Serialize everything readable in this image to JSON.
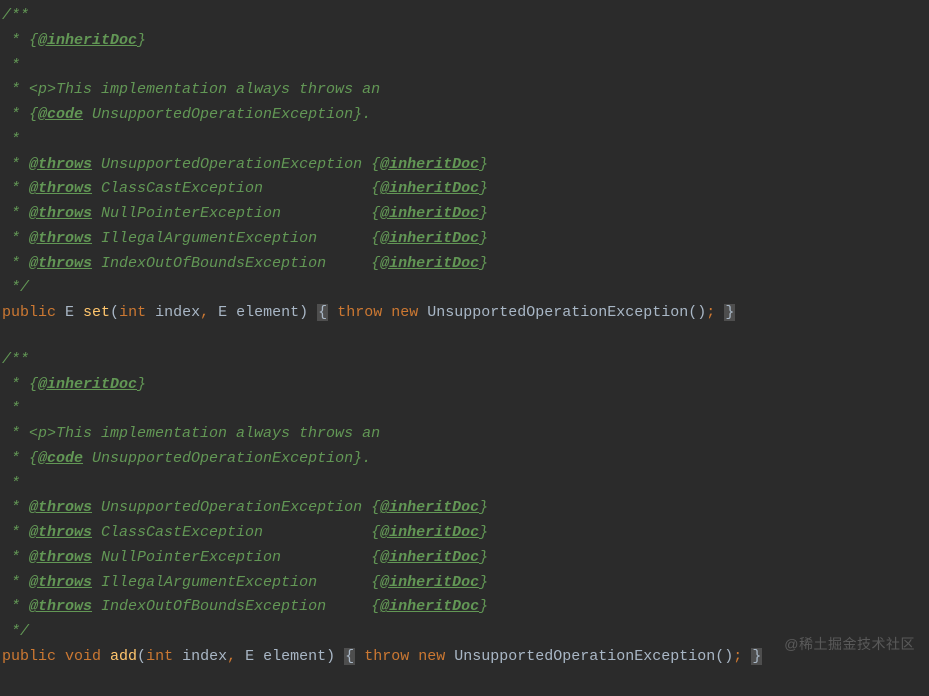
{
  "blocks": [
    {
      "doc": {
        "open": "/**",
        "inheritHeader": {
          "prefix": " * {",
          "tag": "@inheritDoc",
          "suffix": "}"
        },
        "blank1": " *",
        "desc1": {
          "prefix": " * <p>",
          "text": "This implementation always throws an"
        },
        "desc2": {
          "prefix": " * {",
          "tag": "@code",
          "text": " UnsupportedOperationException}."
        },
        "blank2": " *",
        "throws": [
          {
            "prefix": " * ",
            "tag": "@throws",
            "exc": " UnsupportedOperationException ",
            "open": "{",
            "tag2": "@inheritDoc",
            "close": "}"
          },
          {
            "prefix": " * ",
            "tag": "@throws",
            "exc": " ClassCastException            ",
            "open": "{",
            "tag2": "@inheritDoc",
            "close": "}"
          },
          {
            "prefix": " * ",
            "tag": "@throws",
            "exc": " NullPointerException          ",
            "open": "{",
            "tag2": "@inheritDoc",
            "close": "}"
          },
          {
            "prefix": " * ",
            "tag": "@throws",
            "exc": " IllegalArgumentException      ",
            "open": "{",
            "tag2": "@inheritDoc",
            "close": "}"
          },
          {
            "prefix": " * ",
            "tag": "@throws",
            "exc": " IndexOutOfBoundsException     ",
            "open": "{",
            "tag2": "@inheritDoc",
            "close": "}"
          }
        ],
        "close": " */"
      },
      "sig": {
        "kw_public": "public",
        "ret": " E ",
        "name": "set",
        "paramsOpen": "(",
        "kw_int": "int",
        "p1": " index",
        "comma": ",",
        "p2_type": " E ",
        "p2_name": "element",
        "paramsClose": ") ",
        "braceOpen": "{",
        "sp1": " ",
        "kw_throw": "throw",
        "sp2": " ",
        "kw_new": "new",
        "ctor": " UnsupportedOperationException()",
        "semi": ";",
        "sp3": " ",
        "braceClose": "}"
      }
    },
    {
      "doc": {
        "open": "/**",
        "inheritHeader": {
          "prefix": " * {",
          "tag": "@inheritDoc",
          "suffix": "}"
        },
        "blank1": " *",
        "desc1": {
          "prefix": " * <p>",
          "text": "This implementation always throws an"
        },
        "desc2": {
          "prefix": " * {",
          "tag": "@code",
          "text": " UnsupportedOperationException}."
        },
        "blank2": " *",
        "throws": [
          {
            "prefix": " * ",
            "tag": "@throws",
            "exc": " UnsupportedOperationException ",
            "open": "{",
            "tag2": "@inheritDoc",
            "close": "}"
          },
          {
            "prefix": " * ",
            "tag": "@throws",
            "exc": " ClassCastException            ",
            "open": "{",
            "tag2": "@inheritDoc",
            "close": "}"
          },
          {
            "prefix": " * ",
            "tag": "@throws",
            "exc": " NullPointerException          ",
            "open": "{",
            "tag2": "@inheritDoc",
            "close": "}"
          },
          {
            "prefix": " * ",
            "tag": "@throws",
            "exc": " IllegalArgumentException      ",
            "open": "{",
            "tag2": "@inheritDoc",
            "close": "}"
          },
          {
            "prefix": " * ",
            "tag": "@throws",
            "exc": " IndexOutOfBoundsException     ",
            "open": "{",
            "tag2": "@inheritDoc",
            "close": "}"
          }
        ],
        "close": " */"
      },
      "sig": {
        "kw_public": "public",
        "ret_kw": " void ",
        "name": "add",
        "paramsOpen": "(",
        "kw_int": "int",
        "p1": " index",
        "comma": ",",
        "p2_type": " E ",
        "p2_name": "element",
        "paramsClose": ") ",
        "braceOpen": "{",
        "sp1": " ",
        "kw_throw": "throw",
        "sp2": " ",
        "kw_new": "new",
        "ctor": " UnsupportedOperationException()",
        "semi": ";",
        "sp3": " ",
        "braceClose": "}"
      }
    }
  ],
  "watermark": "@稀土掘金技术社区"
}
